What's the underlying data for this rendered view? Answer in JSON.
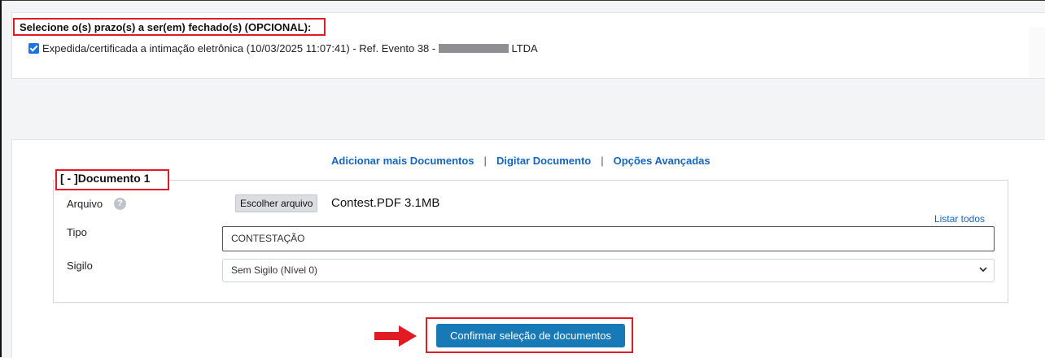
{
  "prazos": {
    "title": "Selecione o(s) prazo(s) a ser(em) fechado(s) (OPCIONAL):",
    "item_label_before": "Expedida/certificada a intimação eletrônica (10/03/2025 11:07:41) - Ref. Evento 38 - ",
    "item_label_after": " LTDA",
    "item_checked": true
  },
  "links": {
    "add_docs": "Adicionar mais Documentos",
    "separator": "|",
    "type_doc": "Digitar Documento",
    "advanced": "Opções Avançadas"
  },
  "document": {
    "legend": "[ - ]Documento 1",
    "arquivo_label": "Arquivo",
    "help_icon": "?",
    "choose_file_label": "Escolher arquivo",
    "file_name": "Contest.PDF 3.1MB",
    "listar_todos": "Listar todos",
    "tipo_label": "Tipo",
    "tipo_value": "CONTESTAÇÃO",
    "sigilo_label": "Sigilo",
    "sigilo_value": "Sem Sigilo (Nível 0)"
  },
  "confirm_label": "Confirmar seleção de documentos",
  "colors": {
    "highlight": "#e01b24",
    "link": "#1565c0",
    "primary_button": "#1779b5",
    "checkbox": "#1a73e8"
  }
}
